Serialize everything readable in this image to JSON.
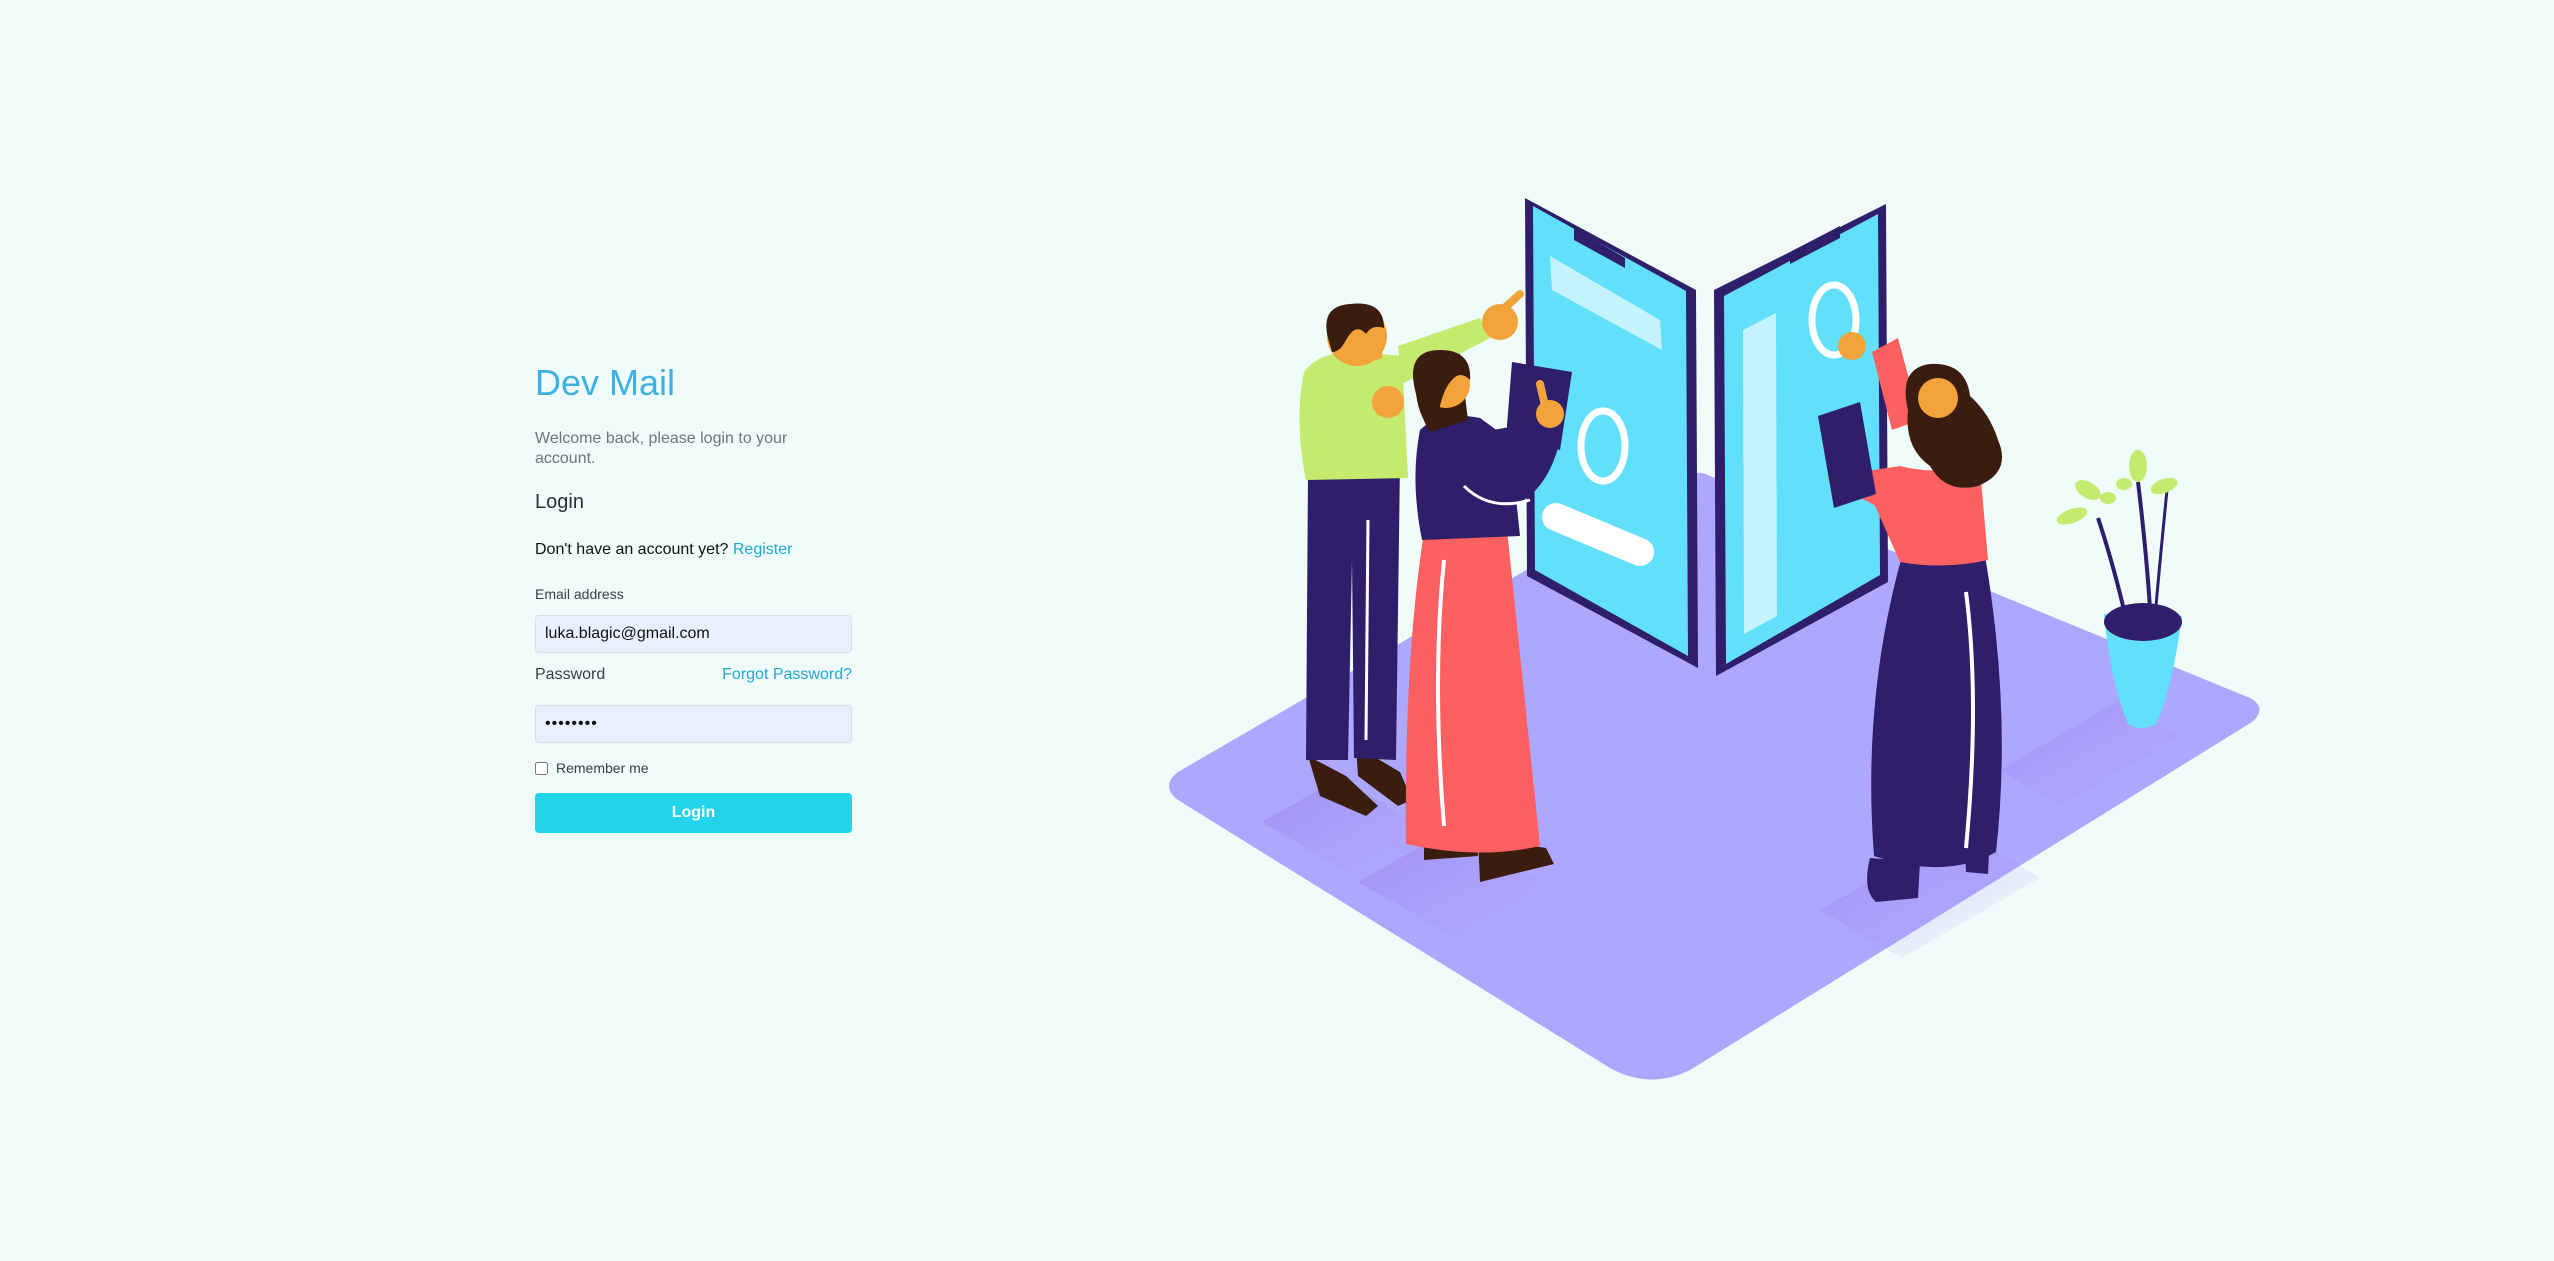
{
  "app": {
    "title": "Dev Mail",
    "welcome": "Welcome back, please login to your account."
  },
  "login_form": {
    "section_title": "Login",
    "register_prompt": "Don't have an account yet?",
    "register_link": "Register",
    "email_label": "Email address",
    "email_value": "luka.blagic@gmail.com",
    "password_label": "Password",
    "forgot_password_link": "Forgot Password?",
    "password_value": "password",
    "remember_me_label": "Remember me",
    "remember_me_checked": false,
    "submit_label": "Login"
  },
  "colors": {
    "background": "#effcfa",
    "title": "#3eb0e2",
    "link": "#21a9d4",
    "button": "#22d3ea",
    "input_background": "#e8effd",
    "platform": "#ada7fd",
    "phone_screen": "#62dffb",
    "navy": "#2f1e6a"
  },
  "illustration": {
    "name": "team-collaboration-illustration",
    "subjects": [
      "person",
      "person",
      "person",
      "phone-screen",
      "phone-screen",
      "plant-pot"
    ]
  }
}
